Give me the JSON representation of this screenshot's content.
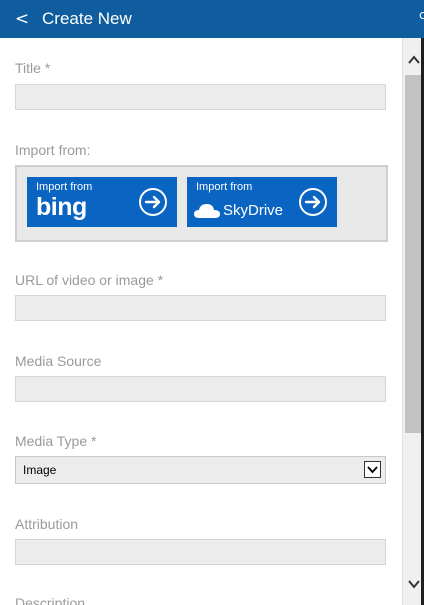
{
  "header": {
    "back_label": "<",
    "title": "Create New",
    "edge_text": "c"
  },
  "form": {
    "title_label": "Title *",
    "import_label": "Import from:",
    "import_bing": {
      "prefix": "Import from",
      "brand": "bing"
    },
    "import_skydrive": {
      "prefix": "Import from",
      "brand": "SkyDrive"
    },
    "url_label": "URL of video or image *",
    "media_source_label": "Media Source",
    "media_type_label": "Media Type *",
    "media_type_value": "Image",
    "attribution_label": "Attribution",
    "description_label": "Description"
  },
  "colors": {
    "header_bg": "#0f5d9e",
    "import_button_bg": "#0a64c2",
    "field_bg": "#ececec",
    "label_text": "#9a9a9a"
  },
  "icons": {
    "back": "chevron-left-icon",
    "import_arrow": "arrow-right-circle-icon",
    "cloud": "cloud-icon",
    "select_arrow": "chevron-down-icon",
    "scroll_up": "chevron-up-icon",
    "scroll_down": "chevron-down-icon"
  }
}
